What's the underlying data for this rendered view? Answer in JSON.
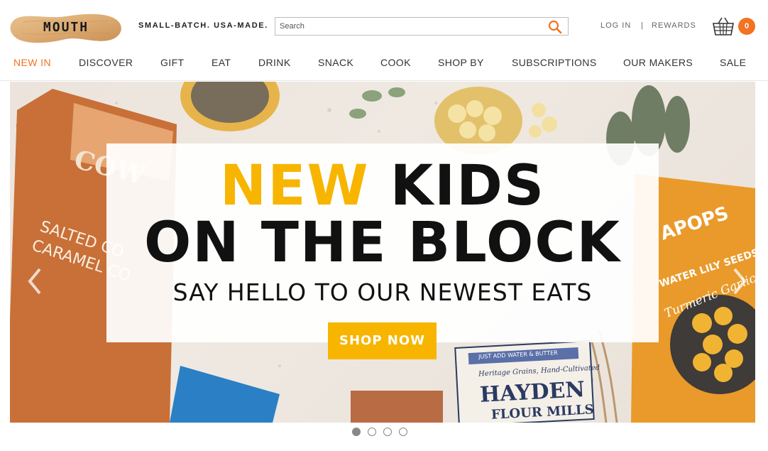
{
  "brand": {
    "logo_text": "MOUTH",
    "tagline": "SMALL-BATCH. USA-MADE.",
    "accent_color": "#f27321",
    "highlight_color": "#f7b500"
  },
  "search": {
    "placeholder": "Search",
    "value": "",
    "icon": "search-icon"
  },
  "account": {
    "login_label": "LOG IN",
    "separator": "|",
    "rewards_label": "REWARDS"
  },
  "cart": {
    "icon": "basket-icon",
    "count": "0"
  },
  "nav": {
    "items": [
      {
        "label": "NEW IN",
        "active": true
      },
      {
        "label": "DISCOVER",
        "active": false
      },
      {
        "label": "GIFT",
        "active": false
      },
      {
        "label": "EAT",
        "active": false
      },
      {
        "label": "DRINK",
        "active": false
      },
      {
        "label": "SNACK",
        "active": false
      },
      {
        "label": "COOK",
        "active": false
      },
      {
        "label": "SHOP BY",
        "active": false
      },
      {
        "label": "SUBSCRIPTIONS",
        "active": false
      },
      {
        "label": "OUR MAKERS",
        "active": false
      },
      {
        "label": "SALE",
        "active": false
      }
    ]
  },
  "hero": {
    "headline_accent": "NEW",
    "headline_rest": "KIDS",
    "headline_line2": "ON THE BLOCK",
    "subheadline": "SAY HELLO TO OUR NEWEST EATS",
    "cta_label": "SHOP NOW",
    "prev_icon": "chevron-left-icon",
    "next_icon": "chevron-right-icon",
    "packages": {
      "caramel_top": "COW",
      "caramel_line1": "SALTED CO",
      "caramel_line2": "CARAMEL CO",
      "lilyseed_brand": "APOPS",
      "lilyseed_line": "WATER LILY SEEDS",
      "lilyseed_flavor": "Turmeric Garlic",
      "hayden_top": "JUST ADD WATER & BUTTER",
      "hayden_sub": "Heritage Grains, Hand-Cultivated",
      "hayden_brand": "HAYDEN",
      "hayden_line": "FLOUR MILLS"
    }
  },
  "carousel": {
    "slide_count": 4,
    "active_index": 0
  }
}
